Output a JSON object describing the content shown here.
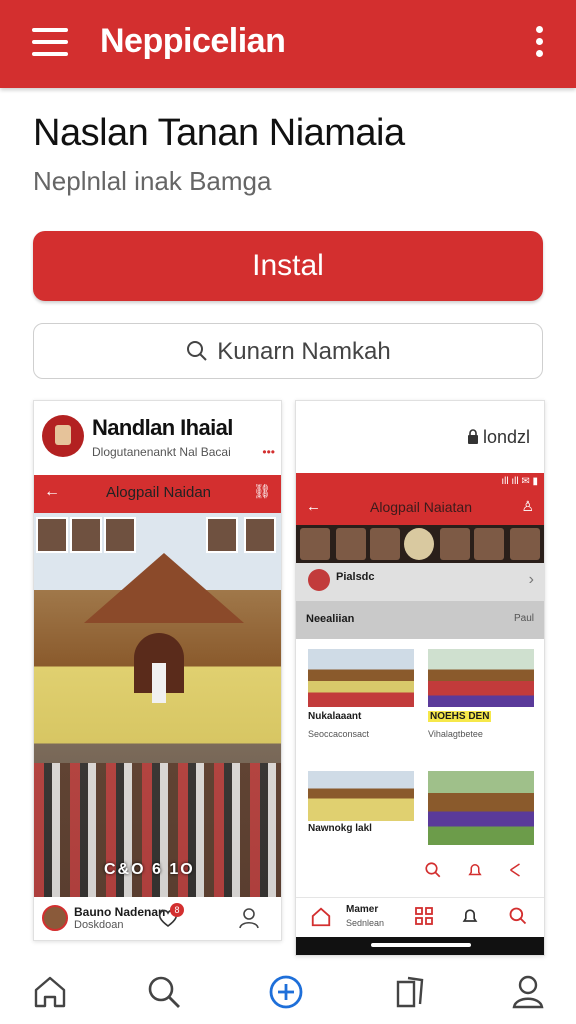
{
  "topbar": {
    "title": "Neppicelian",
    "menu_icon": "hamburger-menu-icon",
    "more_icon": "more-vertical-icon"
  },
  "app": {
    "name": "Naslan Tanan Niamaia",
    "subtitle": "Neplnlal inak Bamga",
    "install_label": "Instal",
    "search_label": "Kunarn Namkah"
  },
  "screenshot1": {
    "app_name": "Nandlan Ihaial",
    "app_sub": "Dlogutanenankt Nal Bacai",
    "dots": "•••",
    "bar_title": "Alogpail Naidan",
    "photo_caption": "C&O 6 1O",
    "footer_name": "Bauno Nadenan",
    "footer_sub": "Doskdoan",
    "badge": "8"
  },
  "screenshot2": {
    "label": "londzl",
    "status": "ıll ıll ✉ ▮",
    "bar_title": "Alogpail Naiatan",
    "profile_name": "Pialsdc",
    "section_left": "Neealiian",
    "section_right": "Paul",
    "cards": [
      {
        "title": "Nukalaaant",
        "sub": "Seoccaconsact",
        "hl": false
      },
      {
        "title": "NOEHS DEN",
        "sub": "Vihalagtbetee",
        "hl": true
      },
      {
        "title": "Nawnokg lakl",
        "sub": "",
        "hl": false
      },
      {
        "title": "",
        "sub": "",
        "hl": false
      }
    ],
    "nav_label": "Mamer",
    "nav_sub": "Sednlean"
  },
  "colors": {
    "brand_red": "#d32f2f"
  }
}
